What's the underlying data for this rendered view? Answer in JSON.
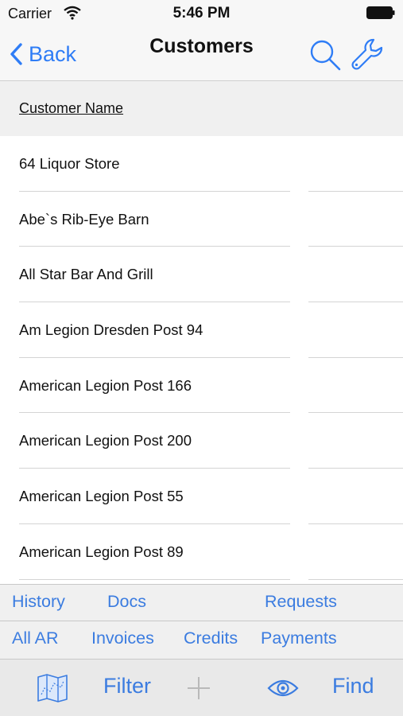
{
  "status_bar": {
    "carrier": "Carrier",
    "time": "5:46 PM"
  },
  "nav": {
    "back_label": "Back",
    "title": "Customers"
  },
  "list_header": {
    "label": "Customer Name"
  },
  "customers": [
    "64 Liquor Store",
    "Abe`s Rib-Eye Barn",
    "All Star Bar And Grill",
    "Am Legion Dresden Post 94",
    "American Legion Post 166",
    "American Legion Post 200",
    "American Legion Post 55",
    "American Legion Post 89"
  ],
  "actions_row1": {
    "history": "History",
    "docs": "Docs",
    "requests": "Requests"
  },
  "actions_row2": {
    "all_ar": "All AR",
    "invoices": "Invoices",
    "credits": "Credits",
    "payments": "Payments"
  },
  "toolbar": {
    "filter": "Filter",
    "find": "Find"
  },
  "icons": {
    "wifi": "wifi-icon",
    "battery": "battery-icon",
    "back": "chevron-left-icon",
    "search": "search-icon",
    "settings": "wrench-icon",
    "map": "map-icon",
    "add": "plus-icon",
    "view": "eye-icon"
  },
  "colors": {
    "accent": "#3b7ce0",
    "header_bg": "#f0f0f0",
    "bar_bg": "#f7f7f7",
    "toolbar_bg": "#e9e9e9"
  }
}
